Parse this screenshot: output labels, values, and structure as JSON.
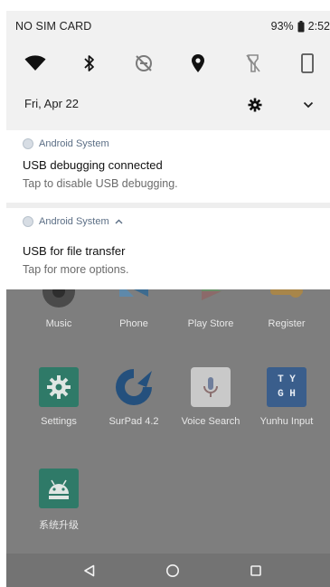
{
  "status_bar": {
    "carrier": "NO SIM CARD",
    "battery_percent": "93%",
    "time": "2:52"
  },
  "quick_settings": {
    "tiles": [
      "wifi-icon",
      "bluetooth-icon",
      "do-not-disturb-icon",
      "location-icon",
      "flashlight-icon",
      "rotation-icon"
    ]
  },
  "date_row": {
    "date": "Fri, Apr 22"
  },
  "notifications": [
    {
      "app": "Android System",
      "title": "USB debugging connected",
      "body": "Tap to disable USB debugging."
    },
    {
      "app": "Android System",
      "title": "USB for file transfer",
      "body": "Tap for more options."
    }
  ],
  "home_apps": {
    "row1": [
      "Music",
      "Phone",
      "Play Store",
      "Register"
    ],
    "row2": [
      "Settings",
      "SurPad 4.2",
      "Voice Search",
      "Yunhu Input"
    ],
    "row3": [
      "系统升级"
    ],
    "yunhu_icon_text": [
      "T Y",
      "G H"
    ]
  },
  "colors": {
    "shade_bg": "#f1f1f1",
    "dim_overlay": "#7e7e7e",
    "app_label": "#5b6e85"
  }
}
